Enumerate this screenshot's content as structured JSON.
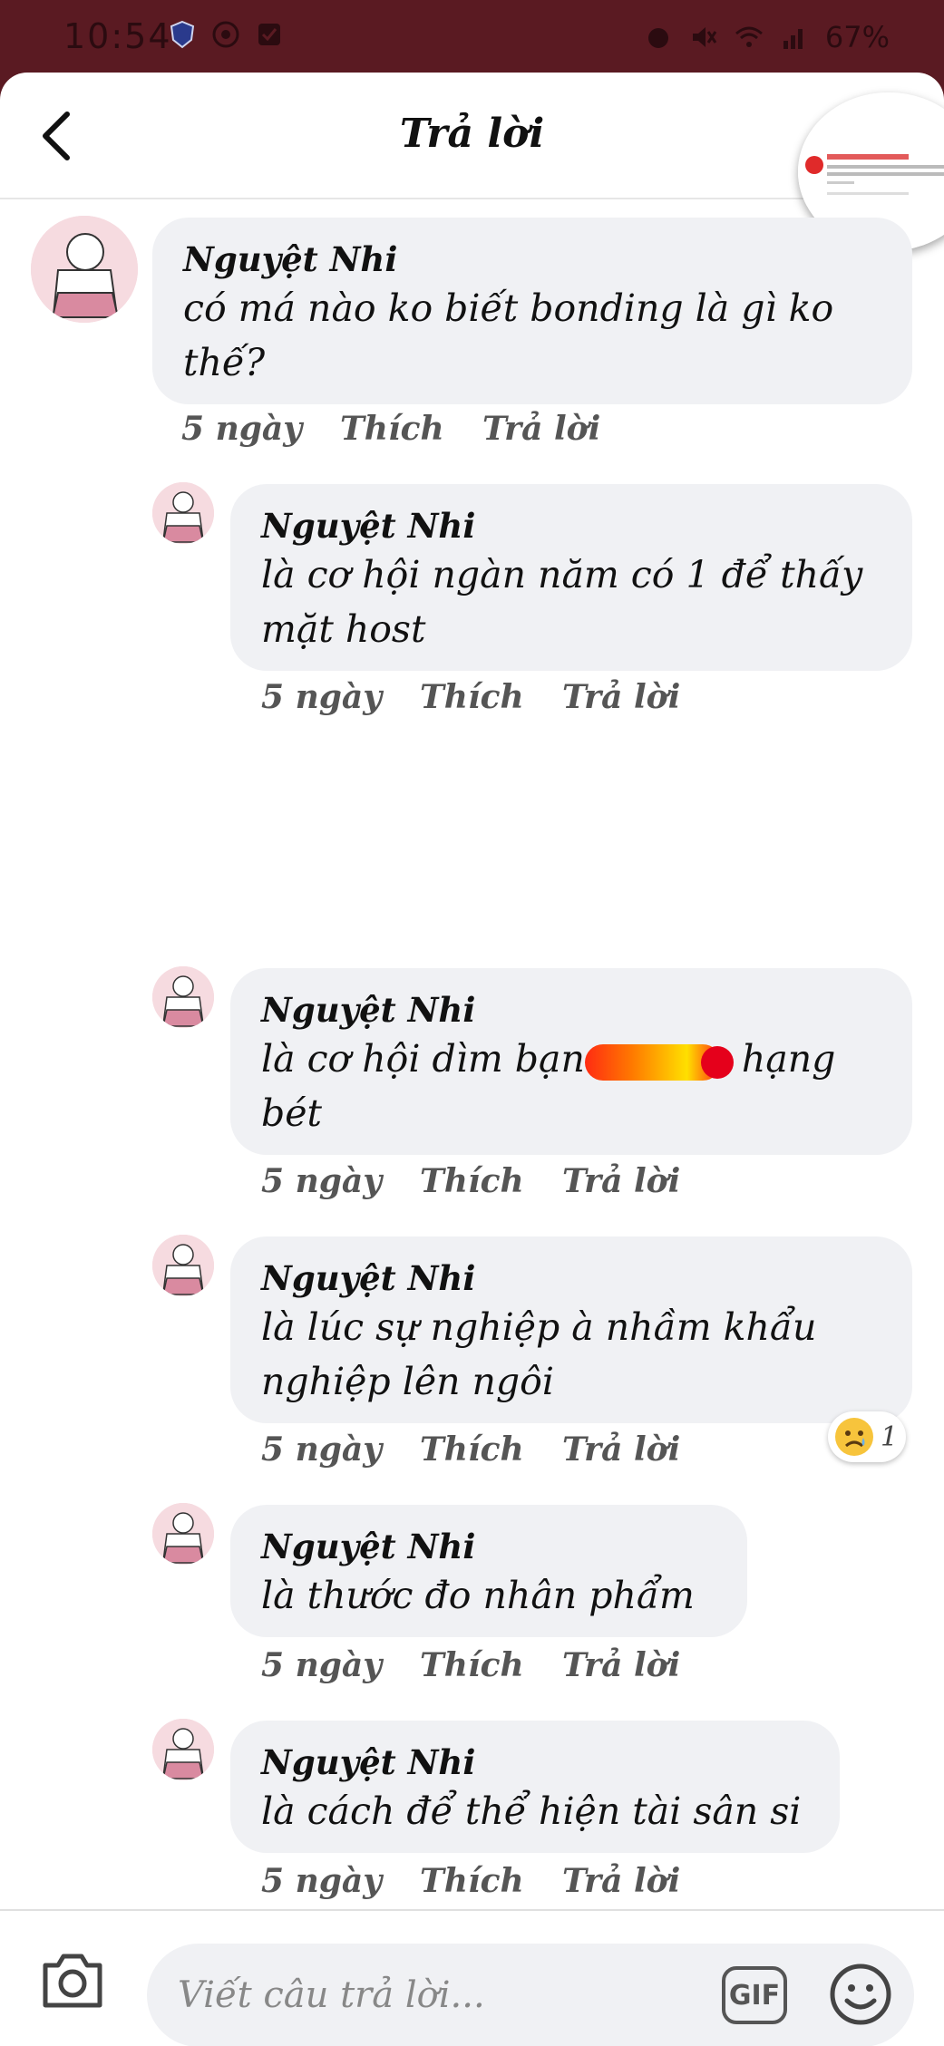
{
  "status_bar": {
    "time": "10:54",
    "battery": "67%"
  },
  "header": {
    "title": "Trả lời"
  },
  "comments": [
    {
      "author": "Nguyệt Nhi",
      "text": "có má nào ko biết bonding là gì ko thế?",
      "time": "5 ngày",
      "like": "Thích",
      "reply": "Trả lời"
    },
    {
      "author": "Nguyệt Nhi",
      "text": "là cơ hội ngàn năm có 1 để thấy mặt host",
      "time": "5 ngày",
      "like": "Thích",
      "reply": "Trả lời"
    },
    {
      "author": "Nguyệt Nhi",
      "text_before": "là cơ hội dìm bạn",
      "text_after": "hạng",
      "text_line2": "bét",
      "time": "5 ngày",
      "like": "Thích",
      "reply": "Trả lời"
    },
    {
      "author": "Nguyệt Nhi",
      "text": "là lúc sự nghiệp à nhầm khẩu nghiệp lên ngôi",
      "time": "5 ngày",
      "like": "Thích",
      "reply": "Trả lời",
      "reaction_count": "1"
    },
    {
      "author": "Nguyệt Nhi",
      "text": "là thước đo nhân phẩm",
      "time": "5 ngày",
      "like": "Thích",
      "reply": "Trả lời"
    },
    {
      "author": "Nguyệt Nhi",
      "text": "là cách để thể hiện tài sân si",
      "time": "5 ngày",
      "like": "Thích",
      "reply": "Trả lời"
    }
  ],
  "composer": {
    "placeholder": "Viết câu trả lời...",
    "gif_label": "GIF"
  },
  "colors": {
    "status_bar_bg": "#5a1a22",
    "bubble_bg": "#f0f1f4",
    "redaction": "#ff2b12"
  }
}
